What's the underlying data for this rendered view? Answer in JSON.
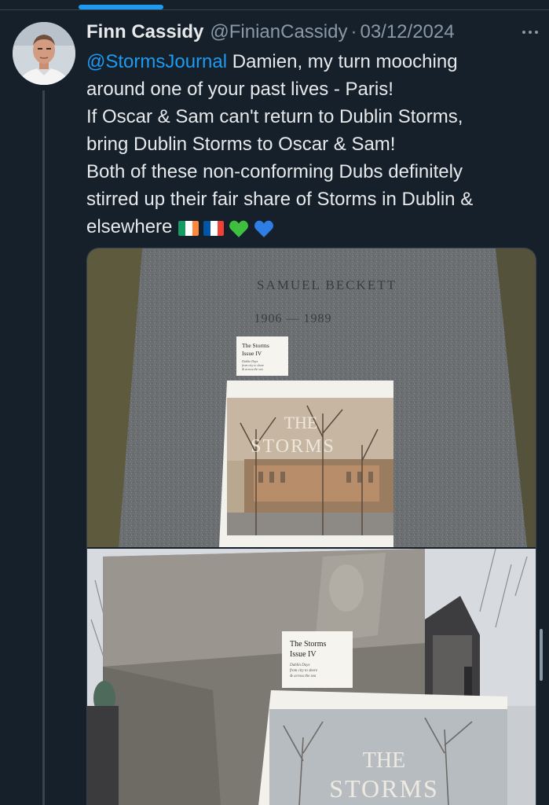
{
  "post": {
    "display_name": "Finn Cassidy",
    "handle": "@FinianCassidy",
    "separator": "·",
    "date": "03/12/2024",
    "text": {
      "mention": "@StormsJournal",
      "line1_rest": " Damien, my turn mooching",
      "line2": "around one of your past lives - Paris!",
      "line3": "If Oscar & Sam can't return to Dublin Storms,",
      "line4": "bring Dublin Storms to Oscar & Sam!",
      "line5": "Both of these non-conforming Dubs definitely",
      "line6": "stirred up their fair share of Storms in Dublin &",
      "line7": "elsewhere"
    },
    "emojis": [
      "flag-ireland-icon",
      "flag-france-icon",
      "green-heart-icon",
      "blue-heart-icon"
    ]
  },
  "media": {
    "photo1": {
      "grave_name": "SAMUEL   BECKETT",
      "grave_years": "1906 — 1989",
      "card_title": "The Storms",
      "card_issue": "Issue IV",
      "card_sub1": "Dublin Days",
      "card_sub2": "from city to shore",
      "card_sub3": "& across the sea",
      "magazine_title_1": "THE",
      "magazine_title_2": "STORMS"
    },
    "photo2": {
      "card_title": "The Storms",
      "card_issue": "Issue IV",
      "card_sub1": "Dublin Days",
      "card_sub2": "from city to shore",
      "card_sub3": "& across the sea",
      "magazine_title_1": "THE",
      "magazine_title_2": "STORMS"
    }
  },
  "colors": {
    "background": "#15202b",
    "accent": "#1d9bf0",
    "secondary_text": "#8b98a5",
    "divider": "#38444d"
  }
}
